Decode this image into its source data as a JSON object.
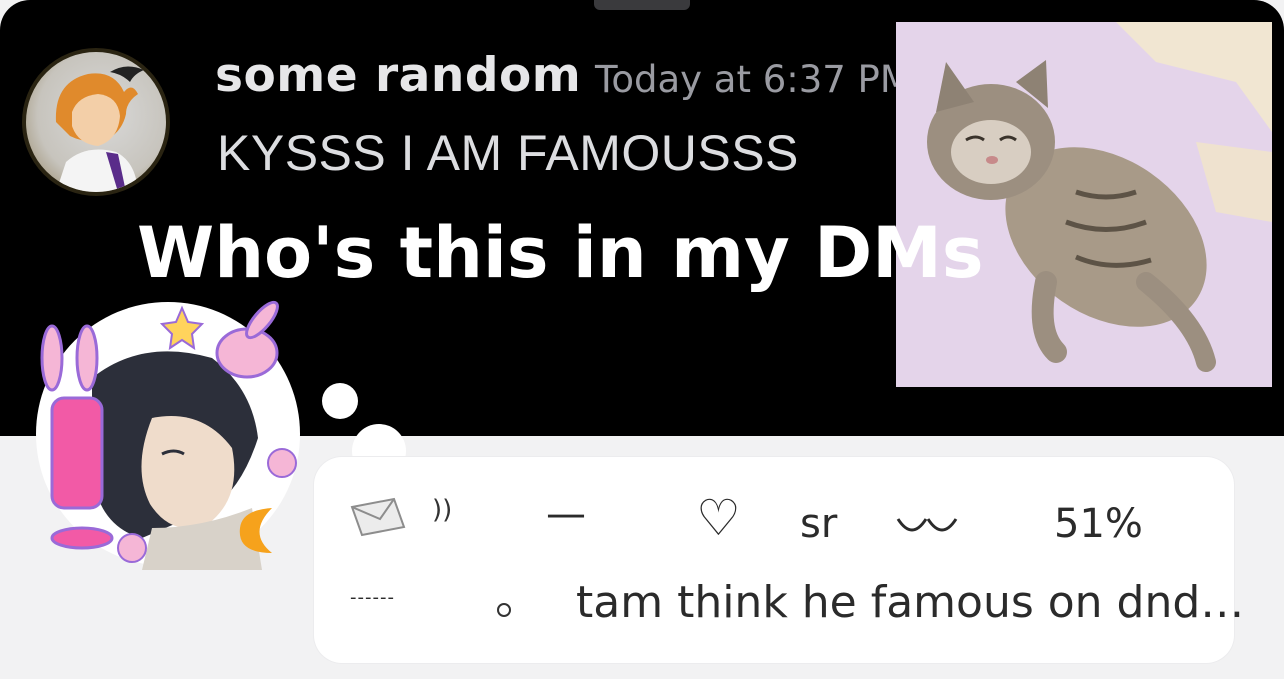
{
  "message": {
    "username": "some random",
    "timestamp": "Today at 6:37 PM",
    "text": "KYSSS I AM FAMOUSSS"
  },
  "caption": "Who's this in my DMs",
  "status_card": {
    "waves": "))",
    "dash": "—",
    "heart": "♡",
    "sr": "sr",
    "percent": "51%",
    "dotted": "------",
    "status_text": "tam think he famous on dnd…"
  },
  "colors": {
    "dark_bg": "#000000",
    "light_bg": "#f2f2f3",
    "card_bg": "#ffffff",
    "username": "#e6e6e8",
    "timestamp": "#9a9ba2"
  },
  "icons": [
    "envelope-icon",
    "heart-icon",
    "eyes-icon",
    "circle-icon",
    "moon-icon",
    "bunny-icon",
    "star-icon",
    "flower-icon"
  ]
}
